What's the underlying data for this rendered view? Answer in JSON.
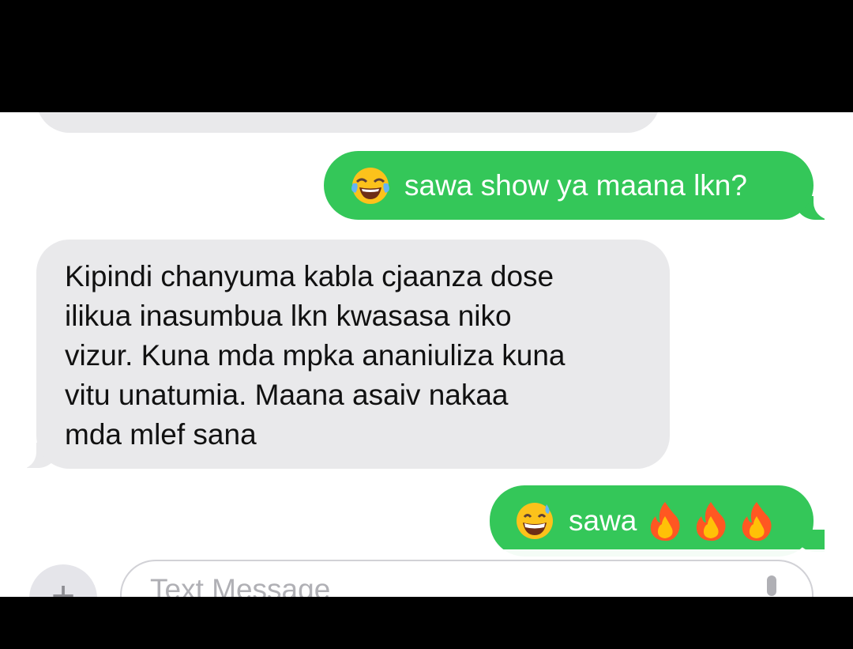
{
  "messages": [
    {
      "direction": "outgoing",
      "emoji": "face-with-tears-of-joy-icon",
      "text": "sawa show ya maana lkn?"
    },
    {
      "direction": "incoming",
      "lines": [
        "Kipindi chanyuma kabla cjaanza dose",
        "ilikua inasumbua lkn kwasasa niko",
        "vizur. Kuna mda mpka ananiuliza kuna",
        "vitu unatumia.  Maana asaiv nakaa",
        "mda mlef sana"
      ]
    },
    {
      "direction": "outgoing",
      "emoji": "grinning-face-with-sweat-icon",
      "text": "sawa",
      "trailing_emojis": [
        "fire-icon",
        "fire-icon",
        "fire-icon"
      ]
    }
  ],
  "composer": {
    "plus_label": "+",
    "placeholder": "Text Message",
    "mic_icon": "microphone-icon"
  },
  "colors": {
    "outgoing_bubble": "#34c759",
    "incoming_bubble": "#e9e9eb",
    "background": "#ffffff",
    "letterbox": "#000000"
  }
}
